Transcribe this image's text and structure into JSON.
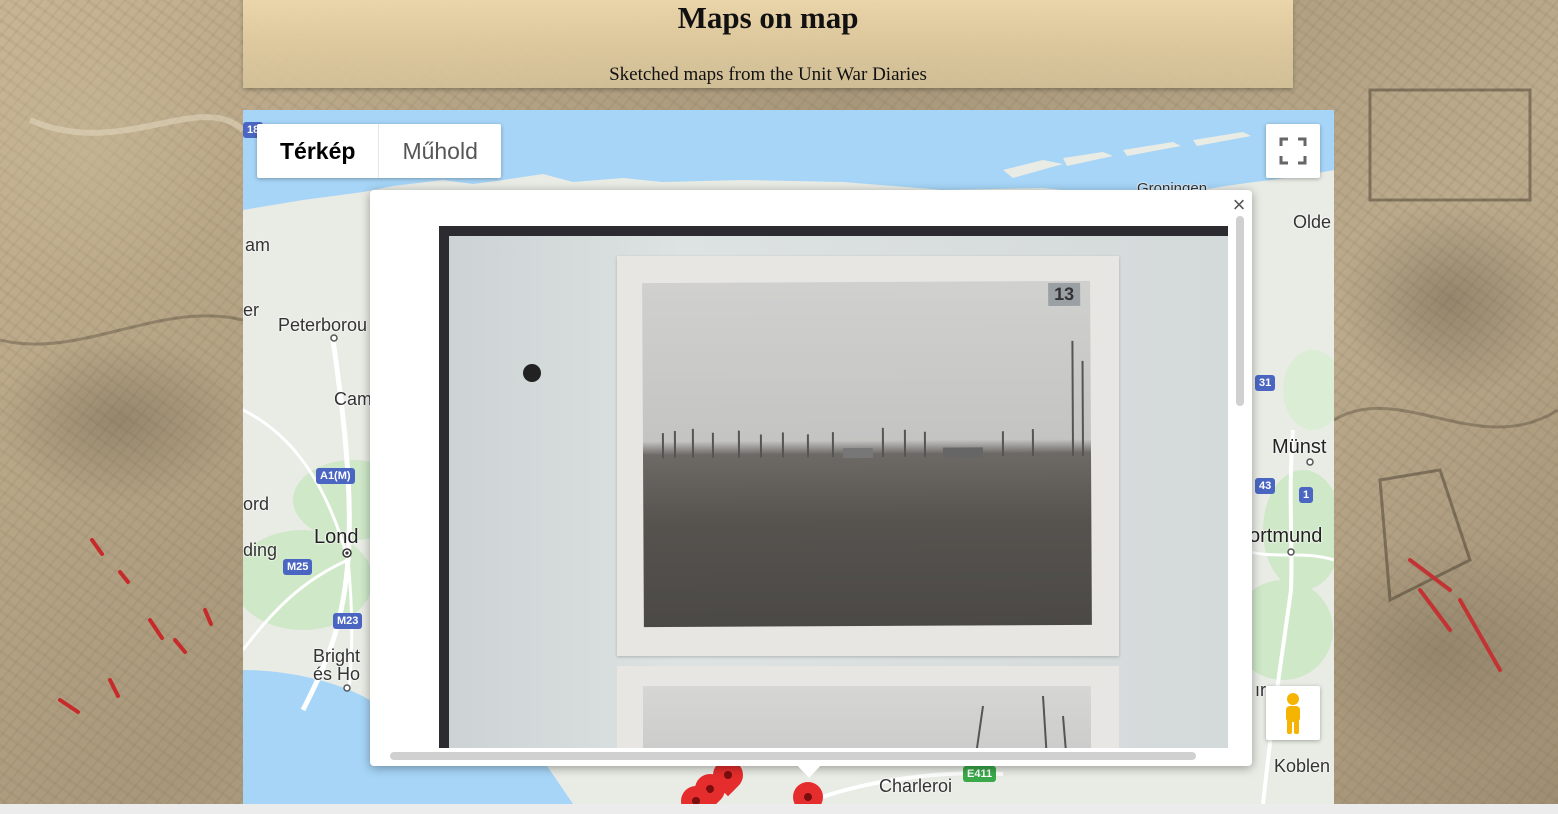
{
  "header": {
    "title": "Maps on map",
    "subtitle": "Sketched maps from the Unit War Diaries"
  },
  "map_controls": {
    "type_map": "Térkép",
    "type_satellite": "Műhold",
    "active_type": "Térkép"
  },
  "map_labels": {
    "am": "am",
    "er": "er",
    "peterborough": "Peterborou",
    "cambridge": "Cam",
    "ord": "ord",
    "london": "Lond",
    "reading": "ding",
    "brighton_1": "Bright",
    "brighton_2": "és Ho",
    "groningen": "Groningen",
    "oldenburg": "Olde",
    "munster": "Münst",
    "dortmund": "ortmund",
    "koblenz": "Koblen",
    "charleroi": "Charleroi",
    "ir": "ır"
  },
  "road_shields": {
    "a1m": "A1(M)",
    "m25": "M25",
    "m23": "M23",
    "e411": "E411",
    "r31": "31",
    "r43": "43",
    "r1": "1",
    "r18": "18"
  },
  "infowindow": {
    "close_glyph": "×",
    "photo_number": "13"
  },
  "colors": {
    "water": "#a6d5f7",
    "land": "#e9ebe5",
    "marker": "#e52d2d"
  }
}
